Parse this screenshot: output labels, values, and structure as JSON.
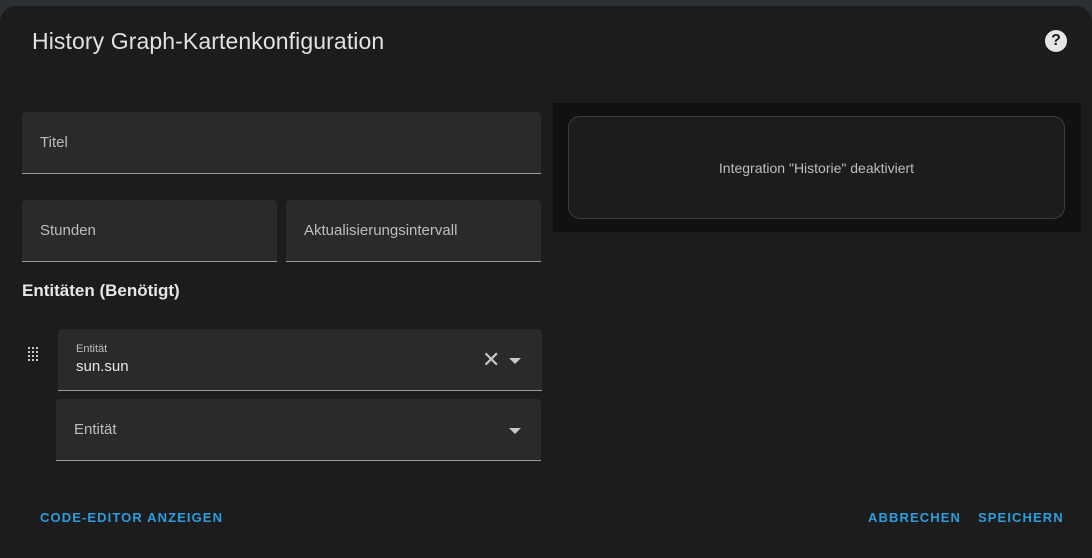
{
  "dialog": {
    "title": "History Graph-Kartenkonfiguration",
    "help_icon": "help-circle-icon"
  },
  "form": {
    "title_label": "Titel",
    "hours_label": "Stunden",
    "refresh_label": "Aktualisierungsintervall",
    "entities_heading": "Entitäten (Benötigt)",
    "entity_1": {
      "label": "Entität",
      "value": "sun.sun"
    },
    "entity_new": {
      "label": "Entität"
    }
  },
  "preview": {
    "message": "Integration \"Historie\" deaktiviert"
  },
  "footer": {
    "code_editor": "CODE-EDITOR ANZEIGEN",
    "cancel": "ABBRECHEN",
    "save": "SPEICHERN"
  },
  "colors": {
    "accent": "#2a9ee0",
    "background": "#1c1c1c",
    "field": "#2a2a2a"
  }
}
